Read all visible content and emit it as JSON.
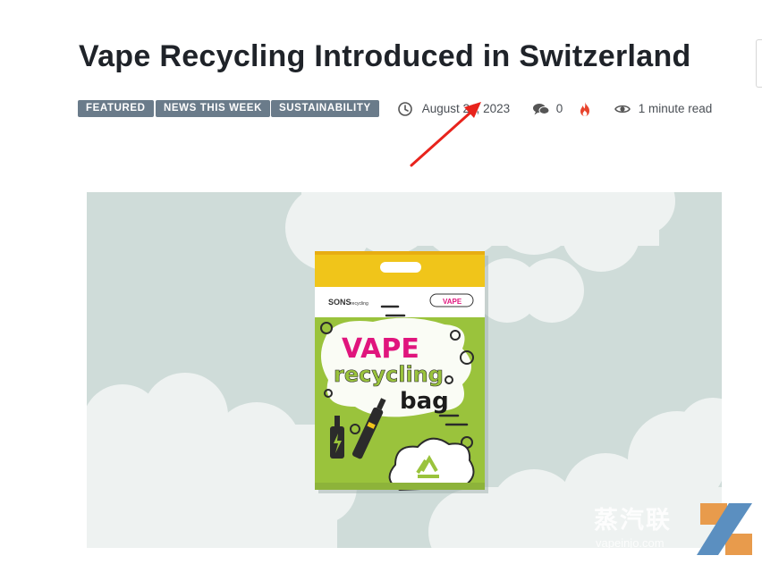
{
  "article": {
    "title": "Vape Recycling Introduced in Switzerland",
    "tags": [
      "FEATURED",
      "NEWS THIS WEEK",
      "SUSTAINABILITY"
    ],
    "date": "August 24, 2023",
    "comment_count": "0",
    "read_time": "1 minute read"
  },
  "image": {
    "bag_brand": "SONS",
    "bag_brand_suffix": "recycling",
    "bag_title_line1": "VAPE",
    "bag_title_line2": "recycling",
    "bag_title_line3": "bag",
    "bag_badge": "VAPE"
  },
  "watermark": {
    "text": "蒸汽联",
    "url": "vapeinjo.com"
  },
  "icons": {
    "date": "clock-icon",
    "comments": "comments-icon",
    "trending": "flame-icon",
    "views": "eye-icon"
  },
  "colors": {
    "title": "#1f2329",
    "tag_bg": "#6a7b8a",
    "flame": "#e8432c",
    "annotation_arrow": "#e8231c",
    "bag_green": "#9ac33c",
    "bag_yellow": "#f0c51a",
    "bag_pink": "#e0157d"
  }
}
